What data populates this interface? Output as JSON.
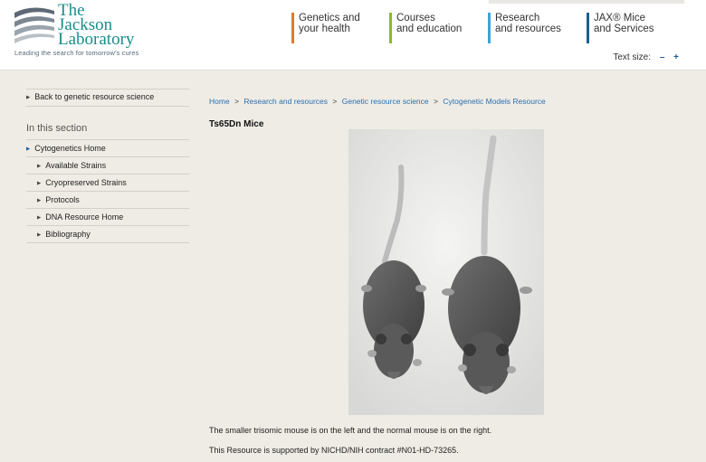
{
  "header": {
    "logo_line1": "The",
    "logo_line2": "Jackson",
    "logo_line3": "Laboratory",
    "logo_tagline": "Leading the search for tomorrow's cures",
    "nav": [
      {
        "line1": "Genetics and",
        "line2": "your health",
        "color": "#e07b24"
      },
      {
        "line1": "Courses",
        "line2": "and education",
        "color": "#8ab833"
      },
      {
        "line1": "Research",
        "line2": "and resources",
        "color": "#3aa6d6"
      },
      {
        "line1": "JAX® Mice",
        "line2": "and Services",
        "color": "#1c5f8f"
      }
    ],
    "text_size_label": "Text size:",
    "text_size_minus": "–",
    "text_size_plus": "+"
  },
  "sidebar": {
    "back_link": "Back to genetic resource science",
    "section_title": "In this section",
    "top_item": "Cytogenetics Home",
    "items": [
      {
        "label": "Available Strains"
      },
      {
        "label": "Cryopreserved Strains"
      },
      {
        "label": "Protocols"
      },
      {
        "label": "DNA Resource Home"
      },
      {
        "label": "Bibliography"
      }
    ]
  },
  "breadcrumb": {
    "items": [
      "Home",
      "Research and resources",
      "Genetic resource science",
      "Cytogenetic Models Resource"
    ],
    "separator": ">"
  },
  "main": {
    "title": "Ts65Dn Mice",
    "caption": "The smaller trisomic mouse is on the left and the normal mouse is on the right.",
    "support": "This Resource is supported by NICHD/NIH contract #N01-HD-73265."
  },
  "colors": {
    "logo_teal": "#1a8c8c",
    "link_blue": "#2a6fb0",
    "page_bg": "#efece5"
  }
}
